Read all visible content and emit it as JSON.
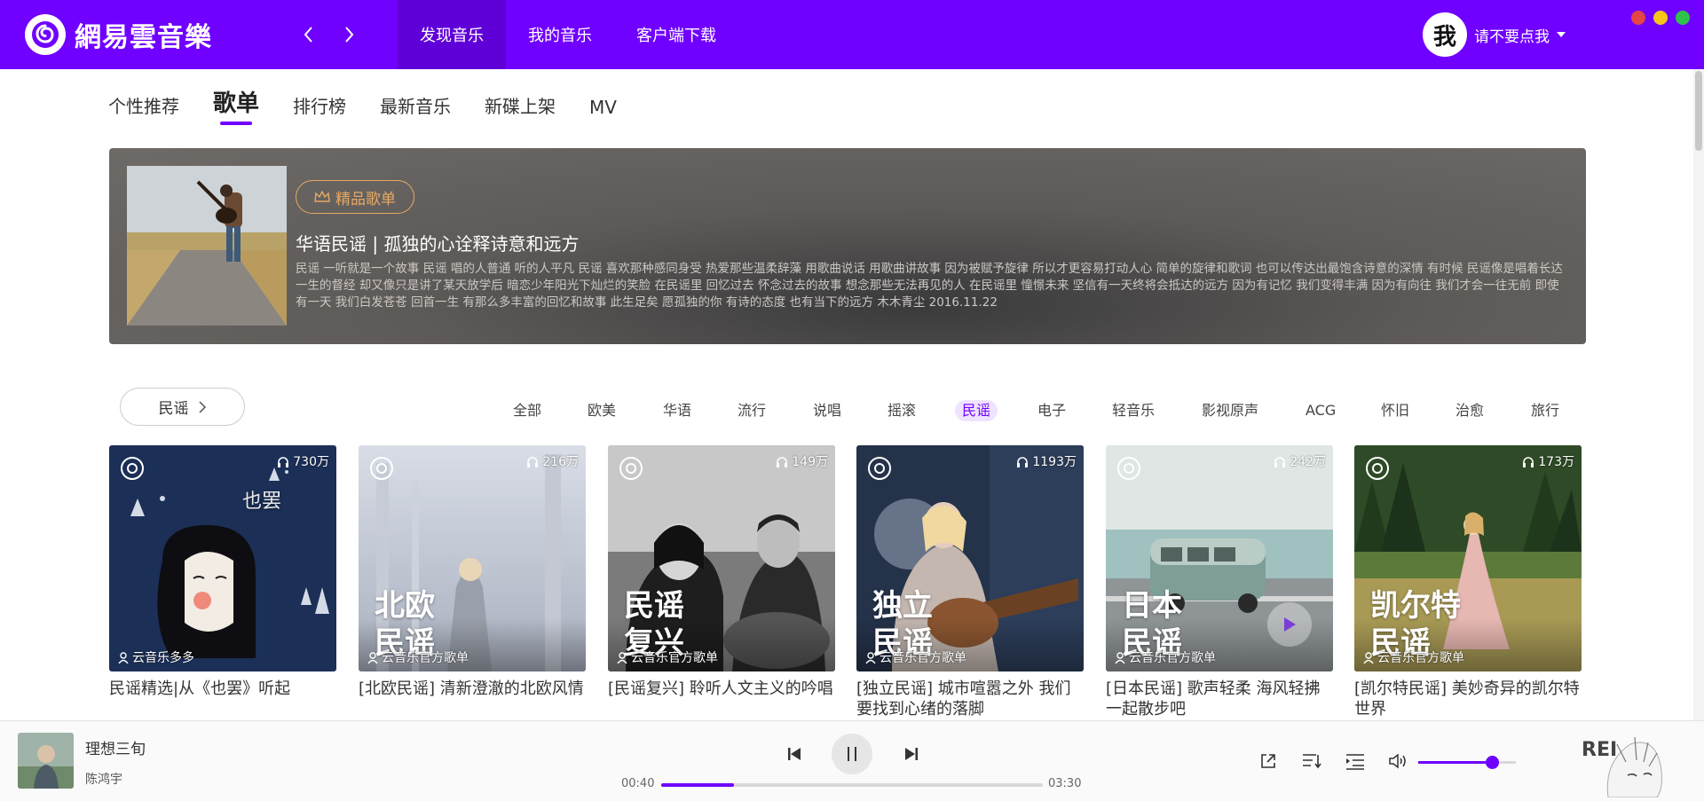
{
  "app": {
    "logo_text": "網易雲音樂",
    "nav": [
      "发现音乐",
      "我的音乐",
      "客户端下载"
    ],
    "user": "请不要点我",
    "avatar_char": "我",
    "window_dots": [
      "#e64545",
      "#f5c518",
      "#2fc24d"
    ]
  },
  "subtabs": [
    "个性推荐",
    "歌单",
    "排行榜",
    "最新音乐",
    "新碟上架",
    "MV"
  ],
  "banner": {
    "badge": "精品歌单",
    "title": "华语民谣 | 孤独的心诠释诗意和远方",
    "desc": "民谣 一听就是一个故事 民谣 唱的人普通 听的人平凡 民谣 喜欢那种感同身受 热爱那些温柔辞藻 用歌曲说话 用歌曲讲故事 因为被赋予旋律 所以才更容易打动人心 简单的旋律和歌词 也可以传达出最饱含诗意的深情 有时候 民谣像是唱着长达一生的督经 却又像只是讲了某天放学后 暗恋少年阳光下灿烂的笑脸 在民谣里 回忆过去 怀念过去的故事 想念那些无法再见的人 在民谣里 憧憬未来 坚信有一天终将会抵达的远方 因为有记忆 我们变得丰满 因为有向往 我们才会一往无前 即使有一天 我们白发苍苍 回首一生 有那么多丰富的回忆和故事 此生足矣 愿孤独的你 有诗的态度 也有当下的远方 木木青尘 2016.11.22"
  },
  "category": {
    "current": "民谣",
    "tags": [
      "全部",
      "欧美",
      "华语",
      "流行",
      "说唱",
      "摇滚",
      "民谣",
      "电子",
      "轻音乐",
      "影视原声",
      "ACG",
      "怀旧",
      "治愈",
      "旅行"
    ],
    "active_index": 6
  },
  "playlists": [
    {
      "plays": "730万",
      "creator": "云音乐多多",
      "title": "民谣精选|从《也罢》听起",
      "overlay": [
        "",
        ""
      ],
      "cover_text": "也罢"
    },
    {
      "plays": "216万",
      "creator": "云音乐官方歌单",
      "title": "[北欧民谣] 清新澄澈的北欧风情",
      "overlay": [
        "北欧",
        "民谣"
      ],
      "cover_text": ""
    },
    {
      "plays": "149万",
      "creator": "云音乐官方歌单",
      "title": "[民谣复兴] 聆听人文主义的吟唱",
      "overlay": [
        "民谣",
        "复兴"
      ],
      "cover_text": ""
    },
    {
      "plays": "1193万",
      "creator": "云音乐官方歌单",
      "title": "[独立民谣] 城市喧嚣之外 我们要找到心绪的落脚",
      "overlay": [
        "独立",
        "民谣"
      ],
      "cover_text": ""
    },
    {
      "plays": "242万",
      "creator": "云音乐官方歌单",
      "title": "[日本民谣] 歌声轻柔 海风轻拂一起散步吧",
      "overlay": [
        "日本",
        "民谣"
      ],
      "cover_text": ""
    },
    {
      "plays": "173万",
      "creator": "云音乐官方歌单",
      "title": "[凯尔特民谣] 美妙奇异的凯尔特世界",
      "overlay": [
        "凯尔特",
        "民谣"
      ],
      "cover_text": ""
    }
  ],
  "player": {
    "song": "理想三旬",
    "artist": "陈鸿宇",
    "current_time": "00:40",
    "total_time": "03:30",
    "progress": 0.19,
    "volume": 0.75,
    "watermark": "REI"
  }
}
